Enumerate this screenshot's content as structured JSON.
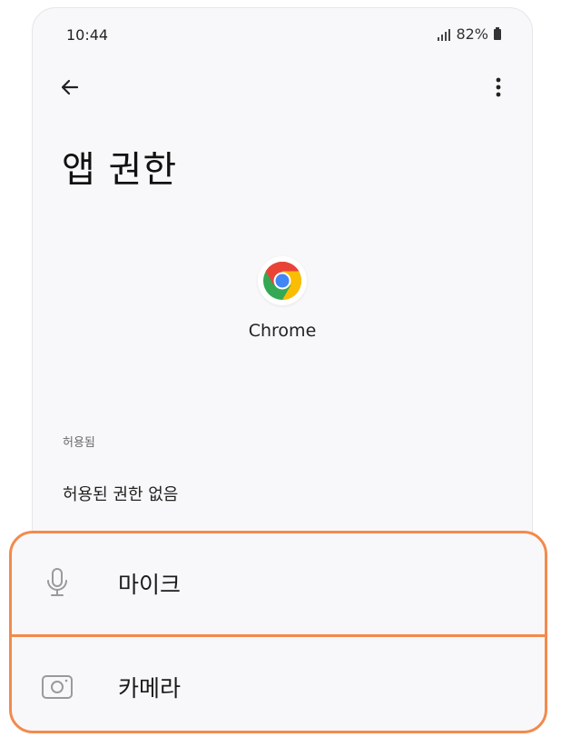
{
  "status_bar": {
    "time": "10:44",
    "battery": "82%"
  },
  "header": {
    "back_icon": "arrow-left-icon",
    "more_icon": "more-vertical-icon"
  },
  "page": {
    "title": "앱 권한",
    "app_name": "Chrome",
    "app_icon": "chrome-logo",
    "section_allowed": "허용됨",
    "no_permissions": "허용된 권한 없음"
  },
  "popup": {
    "border_color": "#f28a4c",
    "items": [
      {
        "label": "마이크",
        "icon": "microphone-icon"
      },
      {
        "label": "카메라",
        "icon": "camera-icon"
      }
    ]
  }
}
